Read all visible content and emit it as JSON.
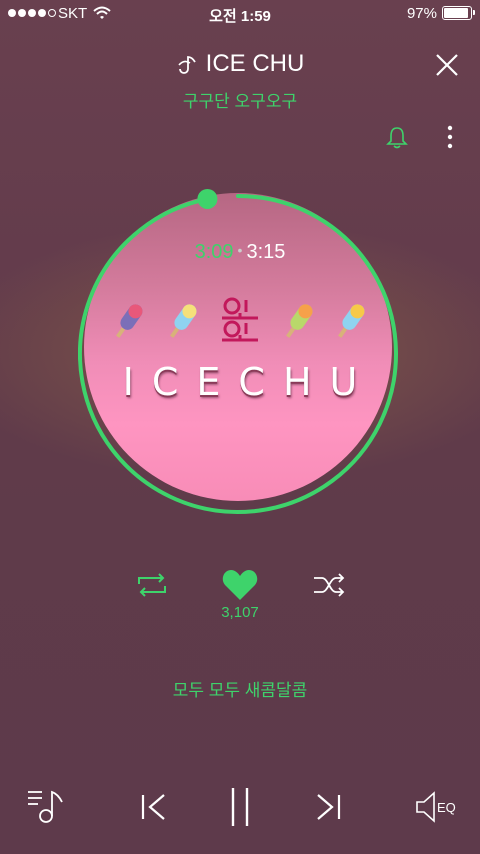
{
  "status_bar": {
    "carrier": "SKT",
    "time": "오전 1:59",
    "battery_text": "97%",
    "battery_level": 0.97,
    "signal_bars": 4
  },
  "player": {
    "song_title": "ICE CHU",
    "artist": "구구단 오구오구",
    "elapsed": "3:09",
    "separator": "•",
    "duration": "3:15",
    "progress": 0.969,
    "album_brand": "ICECHU",
    "likes": "3,107",
    "lyric": "모두 모두 새콤달콤"
  },
  "colors": {
    "accent": "#3ed36b",
    "background": "#5f3a4b",
    "disc_pink": "#fe95c1"
  },
  "icons": {
    "title_icon": "music-note-icon",
    "close": "close-icon",
    "bell": "bell-icon",
    "more": "more-vertical-icon",
    "repeat": "repeat-icon",
    "heart": "heart-icon",
    "shuffle": "shuffle-icon",
    "playlist": "playlist-icon",
    "previous": "previous-icon",
    "pause": "pause-icon",
    "next": "next-icon",
    "eq": "eq-icon"
  }
}
